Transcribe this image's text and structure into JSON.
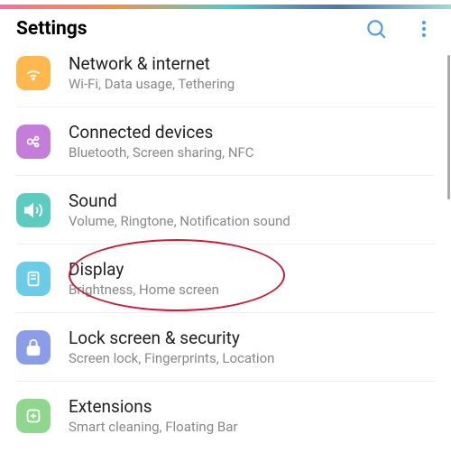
{
  "header": {
    "title": "Settings"
  },
  "items": [
    {
      "title": "Network & internet",
      "subtitle": "Wi-Fi, Data usage, Tethering"
    },
    {
      "title": "Connected devices",
      "subtitle": "Bluetooth, Screen sharing, NFC"
    },
    {
      "title": "Sound",
      "subtitle": "Volume, Ringtone, Notification sound"
    },
    {
      "title": "Display",
      "subtitle": "Brightness, Home screen"
    },
    {
      "title": "Lock screen & security",
      "subtitle": "Screen lock, Fingerprints, Location"
    },
    {
      "title": "Extensions",
      "subtitle": "Smart cleaning, Floating Bar"
    }
  ]
}
